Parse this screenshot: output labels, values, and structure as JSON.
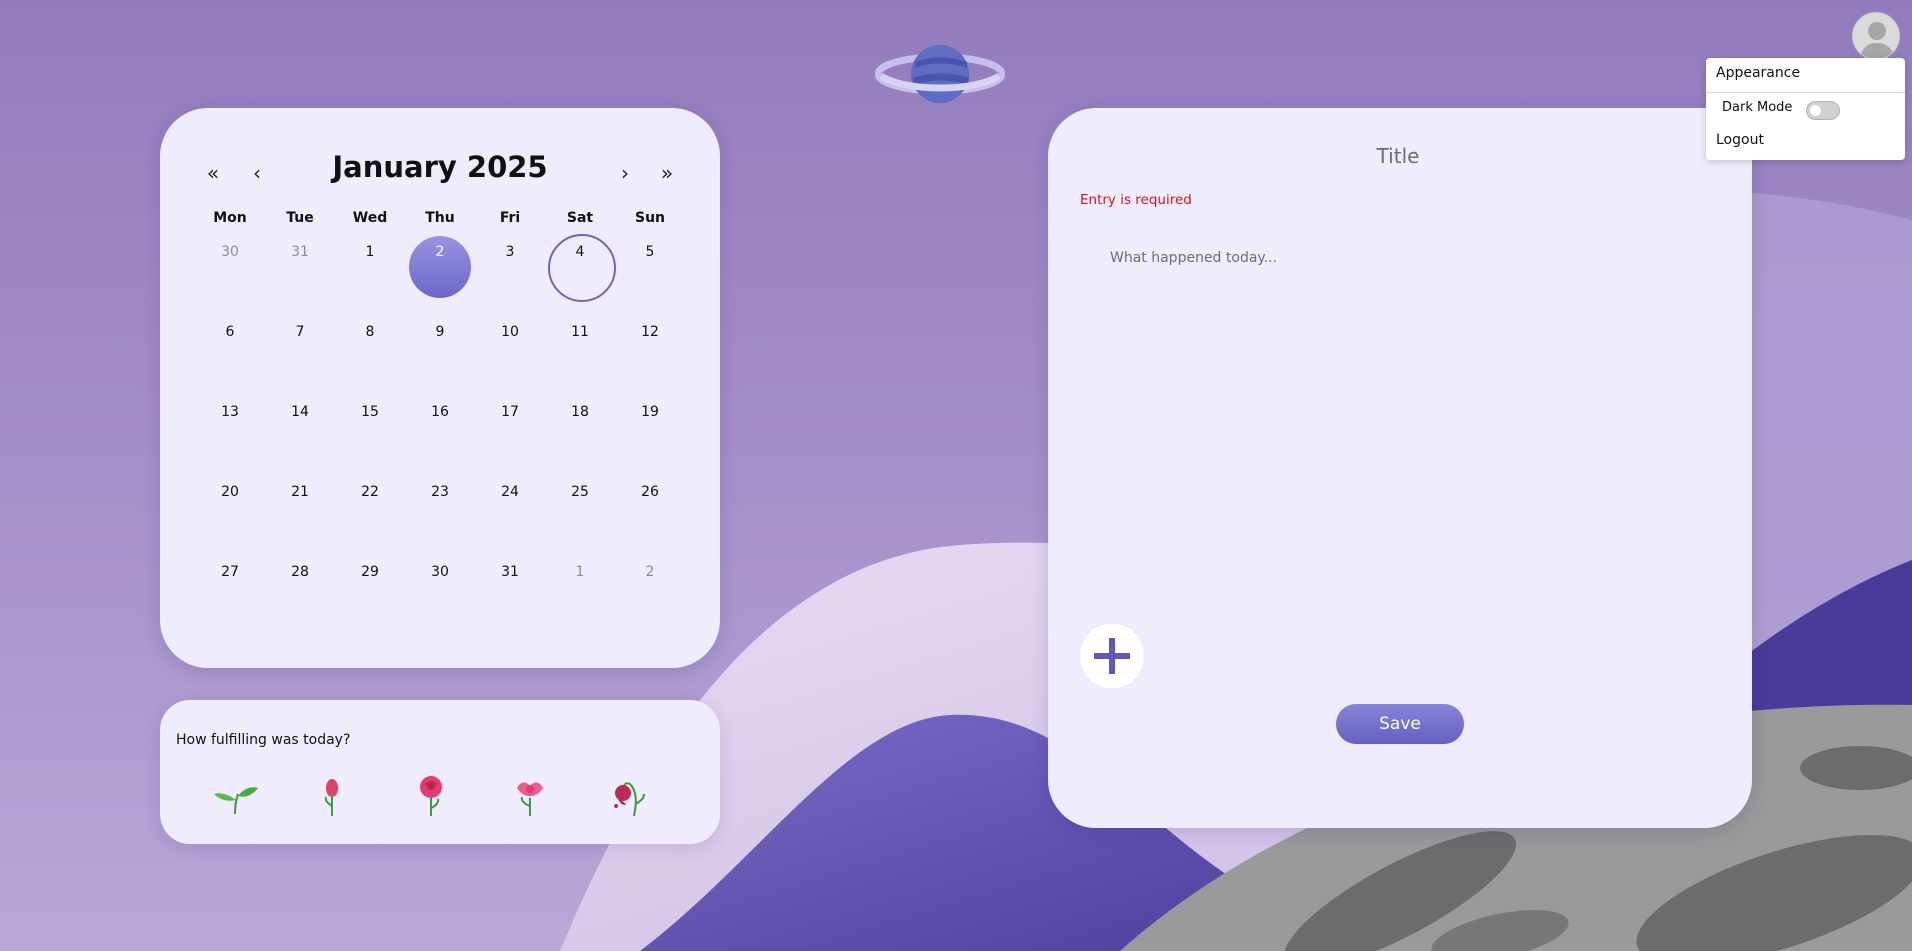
{
  "calendar": {
    "title": "January 2025",
    "nav": {
      "prev_year": "«",
      "prev_month": "‹",
      "next_month": "›",
      "next_year": "»"
    },
    "weekdays": [
      "Mon",
      "Tue",
      "Wed",
      "Thu",
      "Fri",
      "Sat",
      "Sun"
    ],
    "days": [
      {
        "label": "30",
        "muted": true
      },
      {
        "label": "31",
        "muted": true
      },
      {
        "label": "1"
      },
      {
        "label": "2",
        "selected": true
      },
      {
        "label": "3"
      },
      {
        "label": "4",
        "today": true
      },
      {
        "label": "5"
      },
      {
        "label": "6"
      },
      {
        "label": "7"
      },
      {
        "label": "8"
      },
      {
        "label": "9"
      },
      {
        "label": "10"
      },
      {
        "label": "11"
      },
      {
        "label": "12"
      },
      {
        "label": "13"
      },
      {
        "label": "14"
      },
      {
        "label": "15"
      },
      {
        "label": "16"
      },
      {
        "label": "17"
      },
      {
        "label": "18"
      },
      {
        "label": "19"
      },
      {
        "label": "20"
      },
      {
        "label": "21"
      },
      {
        "label": "22"
      },
      {
        "label": "23"
      },
      {
        "label": "24"
      },
      {
        "label": "25"
      },
      {
        "label": "26"
      },
      {
        "label": "27"
      },
      {
        "label": "28"
      },
      {
        "label": "29"
      },
      {
        "label": "30"
      },
      {
        "label": "31"
      },
      {
        "label": "1",
        "muted": true
      },
      {
        "label": "2",
        "muted": true
      }
    ]
  },
  "mood": {
    "question": "How fulfilling was today?",
    "options": [
      {
        "icon": "sprout-icon"
      },
      {
        "icon": "rosebud-icon"
      },
      {
        "icon": "rose-icon"
      },
      {
        "icon": "blossom-icon"
      },
      {
        "icon": "wilted-rose-icon"
      }
    ]
  },
  "entry": {
    "title_placeholder": "Title",
    "error": "Entry is required",
    "body_placeholder": "What happened today...",
    "add_icon": "plus-icon",
    "save_label": "Save"
  },
  "menu": {
    "heading": "Appearance",
    "dark_mode_label": "Dark Mode",
    "dark_mode_on": false,
    "logout_label": "Logout"
  },
  "colors": {
    "accent": "#6c66c8",
    "card_bg": "#efecfd",
    "error": "#d0151a",
    "page_bg": "#9580c0"
  }
}
